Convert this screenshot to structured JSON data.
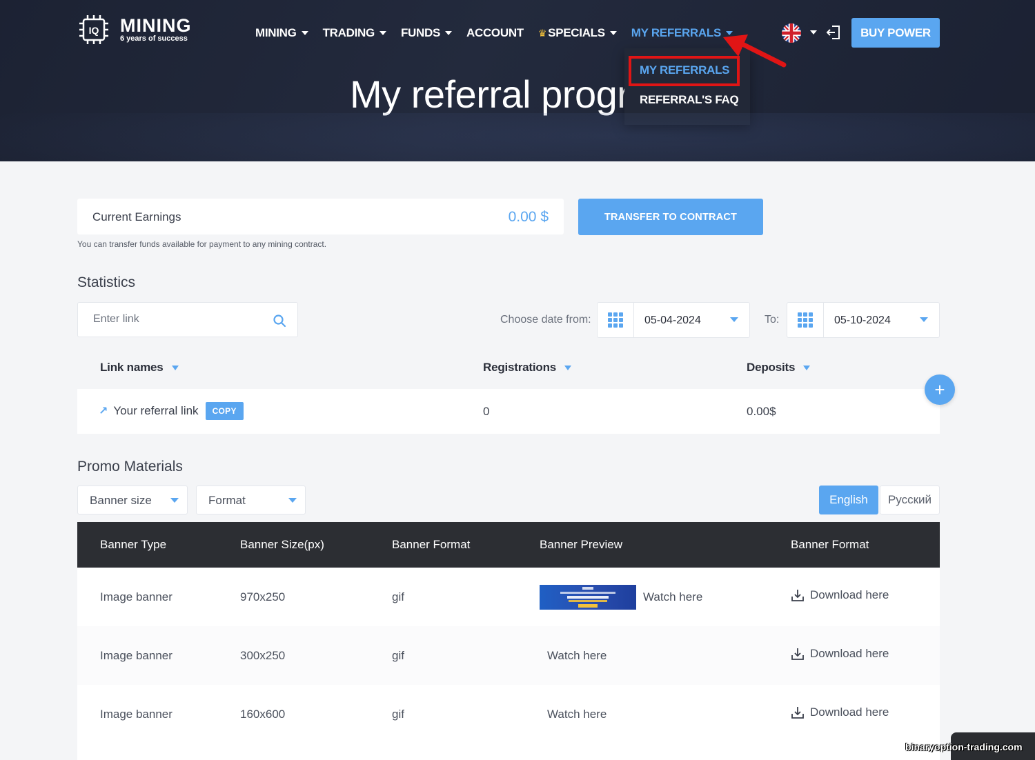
{
  "header": {
    "logo": {
      "name": "MINING",
      "chip_text": "IQ",
      "tagline": "6 years of success"
    },
    "nav": [
      {
        "label": "MINING",
        "has_caret": true
      },
      {
        "label": "TRADING",
        "has_caret": true
      },
      {
        "label": "FUNDS",
        "has_caret": true
      },
      {
        "label": "ACCOUNT",
        "has_caret": false
      },
      {
        "label": "SPECIALS",
        "has_caret": true,
        "icon": "crown-icon"
      },
      {
        "label": "MY REFERRALS",
        "has_caret": true,
        "active": true
      }
    ],
    "language_icon": "uk-flag-icon",
    "logout_icon": "logout-icon",
    "buy_button": "BUY POWER",
    "dropdown": {
      "item1": "MY REFERRALS",
      "item2": "REFERRAL'S FAQ"
    },
    "page_title": "My referral progra"
  },
  "earnings": {
    "label": "Current Earnings",
    "value": "0.00 $",
    "transfer_button": "TRANSFER TO CONTRACT",
    "note": "You can transfer funds available for payment to any mining contract."
  },
  "statistics": {
    "title": "Statistics",
    "search_placeholder": "Enter link",
    "date_from_label": "Choose date from:",
    "date_from": "05-04-2024",
    "date_to_label": "To:",
    "date_to": "05-10-2024",
    "columns": [
      "Link names",
      "Registrations",
      "Deposits"
    ],
    "row": {
      "link_name": "Your referral link",
      "copy_label": "COPY",
      "registrations": "0",
      "deposits": "0.00$"
    }
  },
  "promo": {
    "title": "Promo Materials",
    "filter_size": "Banner size",
    "filter_format": "Format",
    "lang_en": "English",
    "lang_ru": "Русский",
    "columns": [
      "Banner Type",
      "Banner Size(px)",
      "Banner Format",
      "Banner Preview",
      "Banner Format"
    ],
    "rows": [
      {
        "type": "Image banner",
        "size": "970x250",
        "format": "gif",
        "preview": "Watch here",
        "download": "Download here"
      },
      {
        "type": "Image banner",
        "size": "300x250",
        "format": "gif",
        "preview": "Watch here",
        "download": "Download here"
      },
      {
        "type": "Image banner",
        "size": "160x600",
        "format": "gif",
        "preview": "Watch here",
        "download": "Download here"
      }
    ]
  },
  "watermark": "binaryoption-trading.com",
  "colors": {
    "accent": "#5aa6f0",
    "header_bg": "#1c2233",
    "highlight": "#e01515",
    "table_head": "#2c2e33"
  }
}
